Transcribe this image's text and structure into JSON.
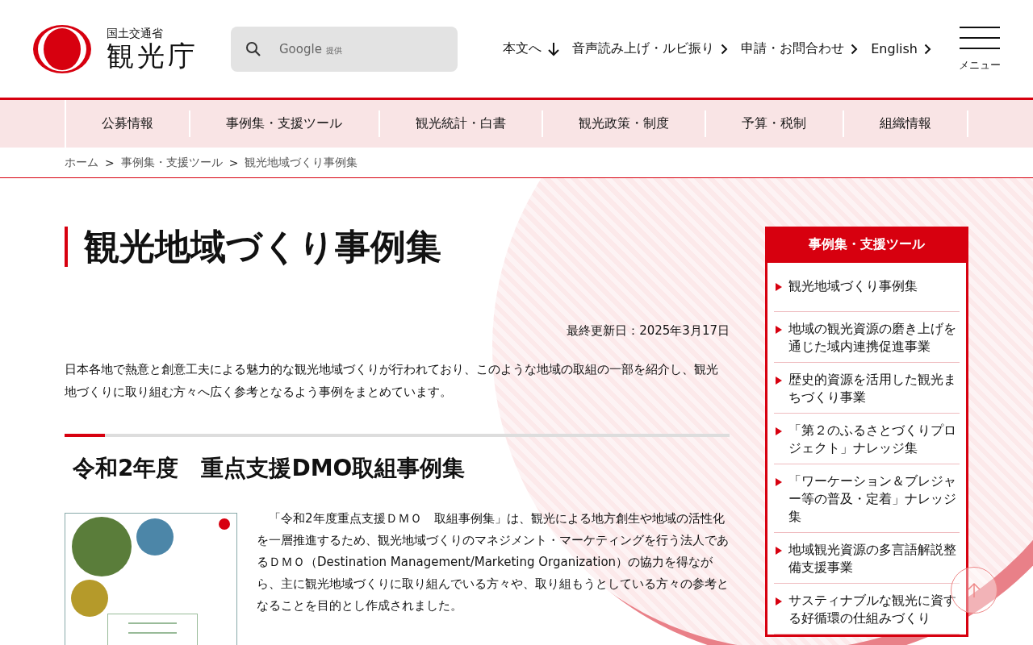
{
  "header": {
    "ministry": "国土交通省",
    "agency": "観光庁",
    "search": {
      "placeholder": "Google",
      "placeholder_suffix": "提供"
    },
    "links": [
      {
        "label": "本文へ",
        "kind": "jump"
      },
      {
        "label": "音声読み上げ・ルビ振り",
        "kind": "page"
      },
      {
        "label": "申請・お問合わせ",
        "kind": "page"
      },
      {
        "label": "English",
        "kind": "page"
      }
    ],
    "menu_label": "メニュー"
  },
  "global_nav": [
    {
      "label": "公募情報"
    },
    {
      "label": "事例集・支援ツール"
    },
    {
      "label": "観光統計・白書"
    },
    {
      "label": "観光政策・制度"
    },
    {
      "label": "予算・税制"
    },
    {
      "label": "組織情報"
    }
  ],
  "breadcrumb_separator": ">",
  "breadcrumb": [
    {
      "label": "ホーム"
    },
    {
      "label": "事例集・支援ツール"
    },
    {
      "label": "観光地域づくり事例集"
    }
  ],
  "page_title": "観光地域づくり事例集",
  "updated": "最終更新日：2025年3月17日",
  "intro": "日本各地で熱意と創意工夫による魅力的な観光地域づくりが行われており、このような地域の取組の一部を紹介し、観光地づくりに取り組む方々へ広く参考となるよう事例をまとめています。",
  "section": {
    "heading": "令和2年度　重点支援DMO取組事例集",
    "body": "「令和2年度重点支援ＤＭＯ　取組事例集」は、観光による地方創生や地域の活性化を一層推進するため、観光地域づくりのマネジメント・マーケティングを行う法人であるＤＭＯ（Destination Management/Marketing Organization）の協力を得ながら、主に観光地域づくりに取り組んでいる方々や、取り組もうとしている方々の参考となることを目的とし作成されました。"
  },
  "sidebar": {
    "title": "事例集・支援ツール",
    "items": [
      {
        "label": "観光地域づくり事例集"
      },
      {
        "label": "地域の観光資源の磨き上げを通じた域内連携促進事業"
      },
      {
        "label": "歴史的資源を活用した観光まちづくり事業"
      },
      {
        "label": "「第２のふるさとづくりプロジェクト」ナレッジ集"
      },
      {
        "label": "「ワーケーション＆ブレジャー等の普及・定着」ナレッジ集"
      },
      {
        "label": "地域観光資源の多言語解説整備支援事業"
      },
      {
        "label": "サスティナブルな観光に資する好循環の仕組みづくり"
      }
    ]
  }
}
